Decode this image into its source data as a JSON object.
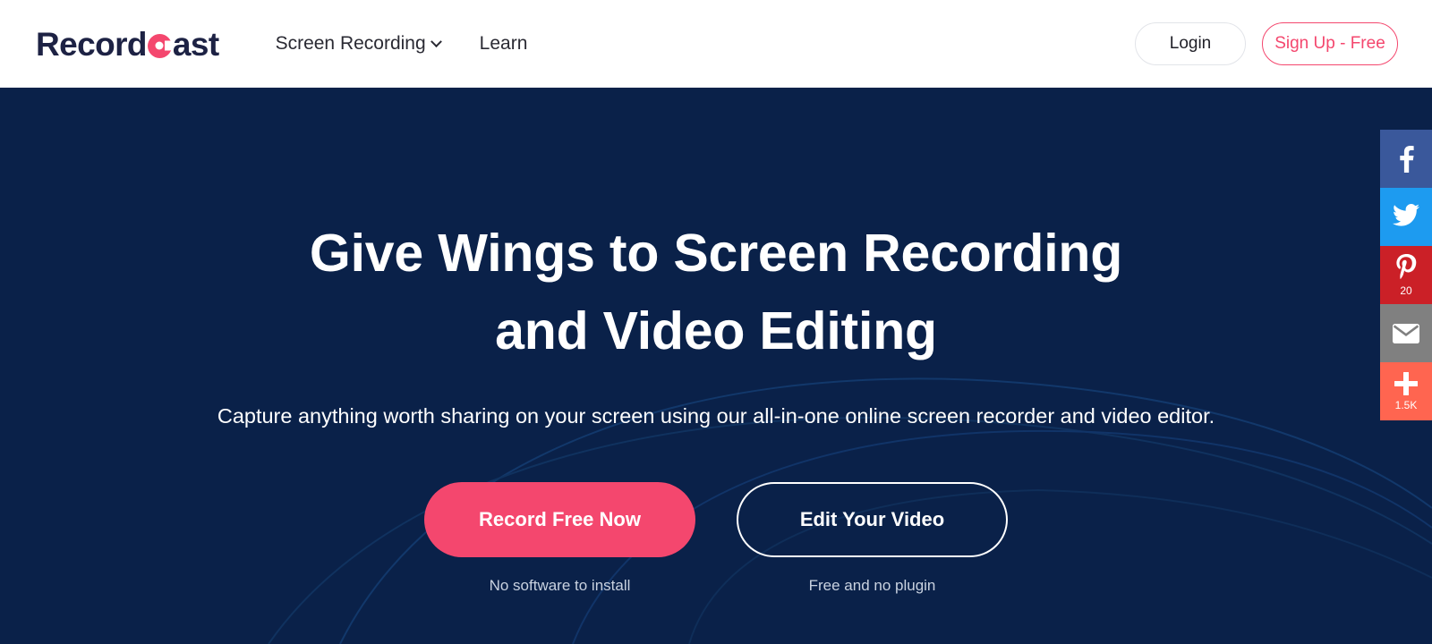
{
  "brand": {
    "logo_prefix": "Record",
    "logo_mark_icon": "record-circle-icon",
    "logo_suffix": "ast",
    "logo_full": "RecordCast",
    "accent_color": "#f4476e",
    "hero_bg_color": "#0a2149",
    "nav_bg_color": "#ffffff"
  },
  "nav": {
    "links": [
      {
        "label": "Screen Recording",
        "has_dropdown": true,
        "icon": "chevron-down-icon"
      },
      {
        "label": "Learn",
        "has_dropdown": false
      }
    ],
    "login_label": "Login",
    "signup_label": "Sign Up - Free"
  },
  "hero": {
    "headline": "Give Wings to Screen Recording and Video Editing",
    "headline_line1": "Give Wings to Screen Recording",
    "headline_line2": "and Video Editing",
    "subhead": "Capture anything worth sharing on your screen using our all-in-one online screen recorder and video editor.",
    "primary_cta": {
      "label": "Record Free Now",
      "note": "No software to install",
      "color": "#f4476e"
    },
    "secondary_cta": {
      "label": "Edit Your Video",
      "note": "Free and no plugin",
      "color": "#ffffff"
    }
  },
  "social_bar": {
    "items": [
      {
        "name": "facebook",
        "icon": "facebook-icon",
        "label": "Facebook",
        "count": "",
        "color": "#3a589b"
      },
      {
        "name": "twitter",
        "icon": "twitter-icon",
        "label": "Twitter",
        "count": "",
        "color": "#1d9bf0"
      },
      {
        "name": "pinterest",
        "icon": "pinterest-icon",
        "label": "Pinterest",
        "count": "20",
        "color": "#cb2027"
      },
      {
        "name": "email",
        "icon": "envelope-icon",
        "label": "Email",
        "count": "",
        "color": "#808080"
      },
      {
        "name": "share",
        "icon": "plus-icon",
        "label": "Share",
        "count": "1.5K",
        "color": "#ff6550"
      }
    ]
  }
}
